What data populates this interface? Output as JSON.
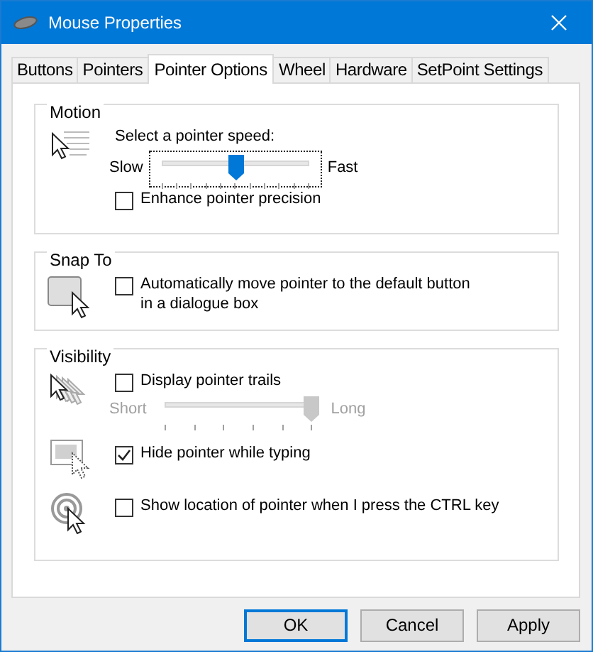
{
  "window": {
    "title": "Mouse Properties"
  },
  "tabs": [
    {
      "label": "Buttons",
      "selected": false
    },
    {
      "label": "Pointers",
      "selected": false
    },
    {
      "label": "Pointer Options",
      "selected": true
    },
    {
      "label": "Wheel",
      "selected": false
    },
    {
      "label": "Hardware",
      "selected": false
    },
    {
      "label": "SetPoint Settings",
      "selected": false
    }
  ],
  "motion": {
    "title": "Motion",
    "speed_label": "Select a pointer speed:",
    "speed_slider": {
      "min_label": "Slow",
      "max_label": "Fast",
      "level": 0.5,
      "focused": true,
      "disabled": false
    },
    "precision": {
      "label": "Enhance pointer precision",
      "checked": false
    }
  },
  "snap_to": {
    "title": "Snap To",
    "auto_move": {
      "label": "Automatically move pointer to the default button in a dialogue box",
      "checked": false
    }
  },
  "visibility": {
    "title": "Visibility",
    "trails": {
      "label": "Display pointer trails",
      "checked": false
    },
    "trails_slider": {
      "min_label": "Short",
      "max_label": "Long",
      "level": 1,
      "focused": false,
      "disabled": true
    },
    "hide_typing": {
      "label": "Hide pointer while typing",
      "checked": true
    },
    "show_location": {
      "label": "Show location of pointer when I press the CTRL key",
      "checked": false
    }
  },
  "buttons": [
    {
      "label": "OK",
      "default": true
    },
    {
      "label": "Cancel",
      "default": false
    },
    {
      "label": "Apply",
      "default": false
    }
  ]
}
